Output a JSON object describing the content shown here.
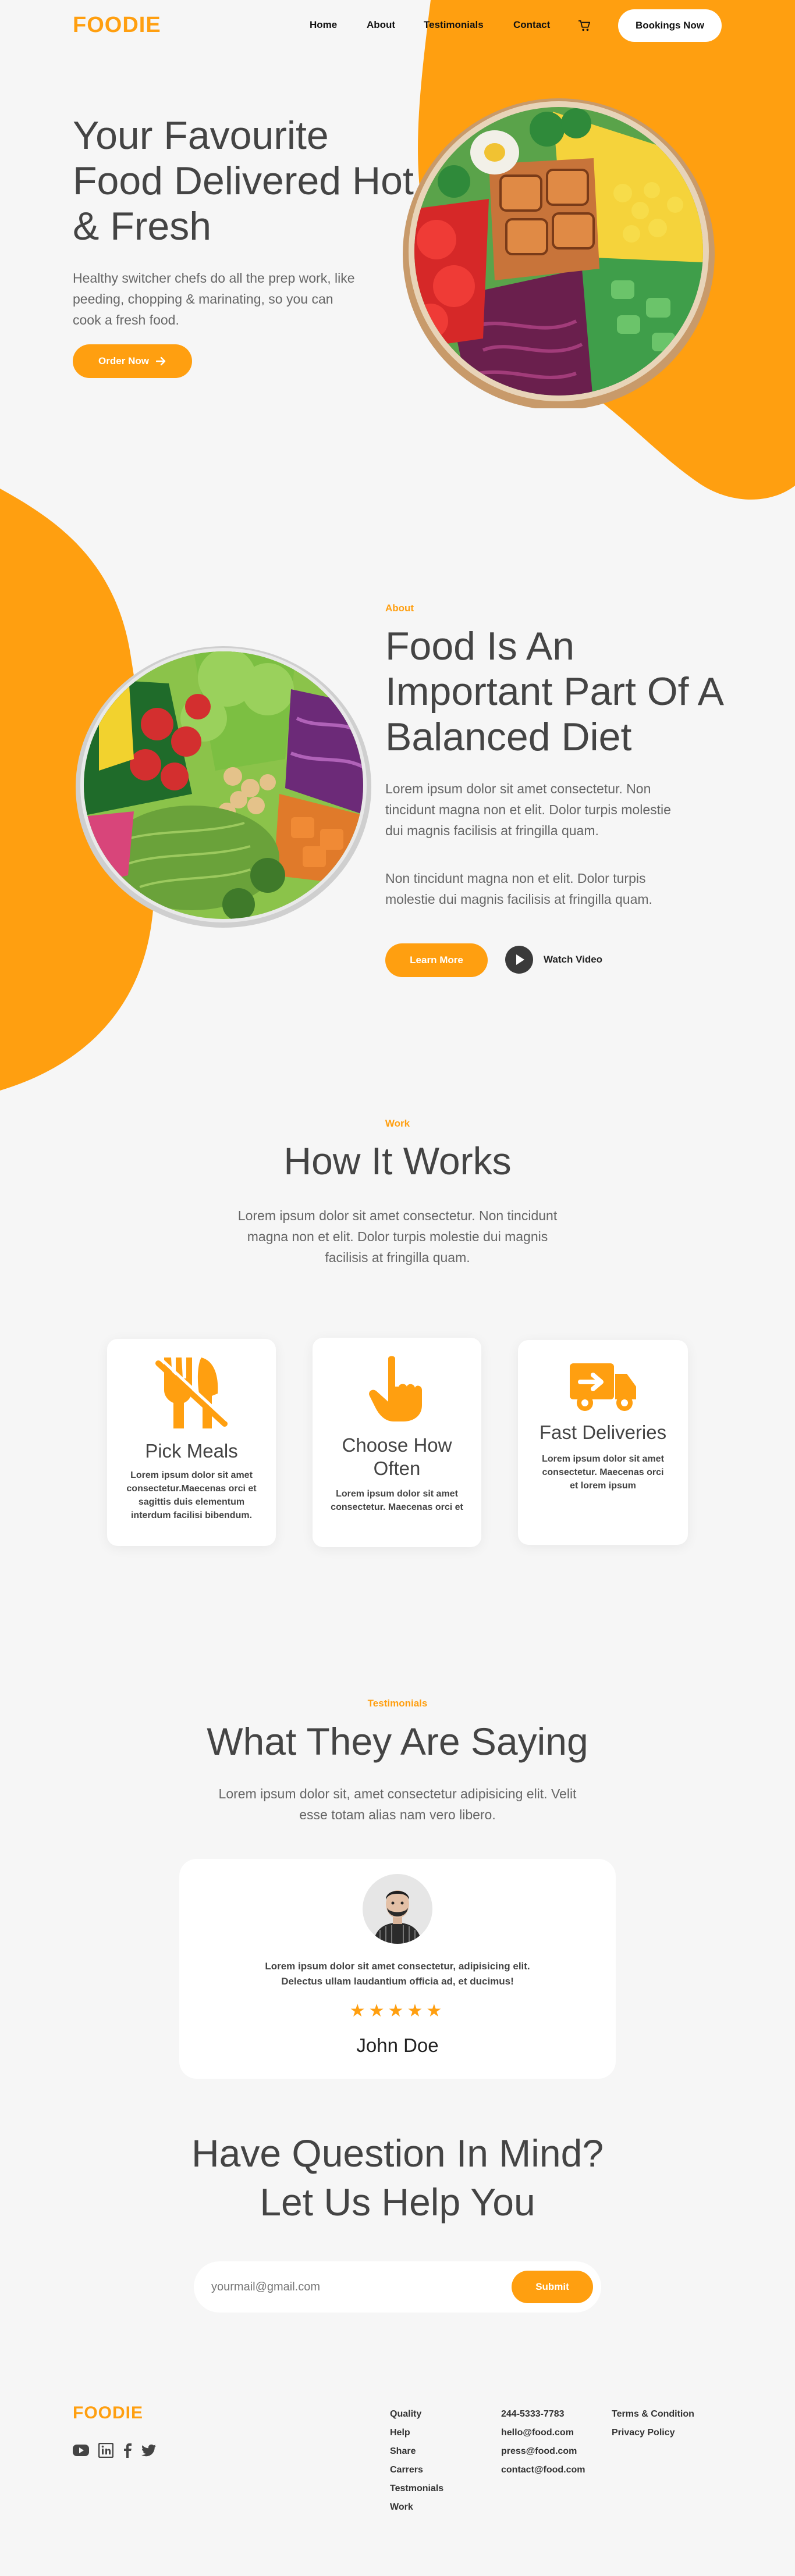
{
  "brand": {
    "logo": "FOODIE",
    "accent": "#ff9f10"
  },
  "nav": {
    "items": [
      "Home",
      "About",
      "Testimonials",
      "Contact"
    ],
    "cart_icon": "cart-icon",
    "booking_label": "Bookings Now"
  },
  "hero": {
    "title": "Your Favourite Food Delivered Hot & Fresh",
    "text": "Healthy switcher chefs do all the prep work, like peeding, chopping & marinating, so you can cook a fresh food.",
    "cta": "Order Now"
  },
  "about": {
    "eyebrow": "About",
    "title": "Food Is An Important Part Of A Balanced Diet",
    "p1": "Lorem ipsum dolor sit amet consectetur. Non tincidunt magna non et elit. Dolor turpis molestie dui magnis facilisis at fringilla quam.",
    "p2": "Non tincidunt magna non et elit. Dolor turpis molestie dui magnis facilisis at fringilla quam.",
    "learn_more": "Learn More",
    "watch_video": "Watch Video"
  },
  "work": {
    "eyebrow": "Work",
    "title": "How It Works",
    "text": "Lorem ipsum dolor sit amet consectetur. Non tincidunt magna non et elit. Dolor turpis molestie dui magnis facilisis at fringilla quam.",
    "cards": [
      {
        "title": "Pick Meals",
        "text": "Lorem ipsum dolor sit amet consectetur.Maecenas orci et sagittis duis elementum interdum facilisi bibendum.",
        "icon": "utensils-icon"
      },
      {
        "title": "Choose How Often",
        "text": "Lorem ipsum dolor sit amet consectetur. Maecenas orci et",
        "icon": "hand-pointer-icon"
      },
      {
        "title": "Fast Deliveries",
        "text": "Lorem ipsum dolor sit amet consectetur. Maecenas orci et lorem ipsum",
        "icon": "truck-icon"
      }
    ]
  },
  "testimonials": {
    "eyebrow": "Testimonials",
    "title": "What They Are Saying",
    "text": "Lorem ipsum dolor sit, amet consectetur adipisicing elit. Velit esse totam alias nam vero libero.",
    "quote": "Lorem ipsum dolor sit amet consectetur, adipisicing elit. Delectus ullam laudantium officia ad, et ducimus!",
    "rating": 5,
    "name": "John Doe"
  },
  "contact": {
    "title_line1": "Have Question In Mind?",
    "title_line2": "Let Us Help You",
    "placeholder": "yourmail@gmail.com",
    "submit": "Submit"
  },
  "footer": {
    "logo": "FOODIE",
    "socials": [
      "youtube-icon",
      "linkedin-icon",
      "facebook-icon",
      "twitter-icon"
    ],
    "col1": [
      "Quality",
      "Help",
      "Share",
      "Carrers",
      "Testmonials",
      "Work"
    ],
    "col2": [
      "244-5333-7783",
      "hello@food.com",
      "press@food.com",
      "contact@food.com"
    ],
    "col3": [
      "Terms & Condition",
      "Privacy Policy"
    ]
  }
}
